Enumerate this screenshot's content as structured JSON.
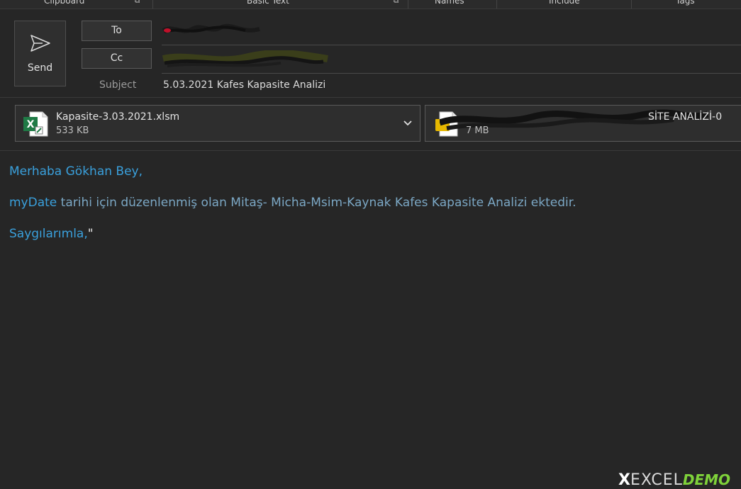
{
  "ribbon": {
    "groups": [
      "Clipboard",
      "Basic Text",
      "Names",
      "Include",
      "Tags"
    ]
  },
  "compose": {
    "send_label": "Send",
    "to_label": "To",
    "cc_label": "Cc",
    "subject_label": "Subject",
    "subject_value": "5.03.2021 Kafes Kapasite Analizi"
  },
  "attachments": [
    {
      "name": "Kapasite-3.03.2021.xlsm",
      "size": "533 KB",
      "icon": "excel-file-icon"
    },
    {
      "name": "SİTE ANALİZİ-0",
      "size": "7 MB",
      "icon": "folder-file-icon"
    }
  ],
  "body": {
    "greeting": "Merhaba Gökhan Bey,",
    "line2_var": "myDate",
    "line2_text": " tarihi için düzenlenmiş olan Mitaş- Micha-Msim-Kaynak Kafes Kapasite Analizi ektedir.",
    "closing": "Saygılarımla,",
    "quote": "\""
  },
  "watermark": {
    "x": "X",
    "excel": "EXCEL",
    "demo": "DEMO"
  },
  "colors": {
    "background": "#262626",
    "body_link": "#3aa0dc",
    "excel_green": "#1f7a45"
  }
}
